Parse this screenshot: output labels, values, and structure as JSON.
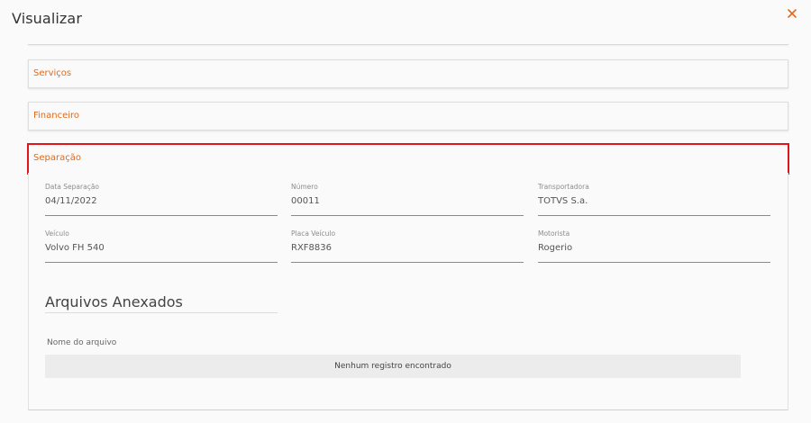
{
  "header": {
    "title": "Visualizar",
    "close_icon": "close-icon",
    "accent_color": "#e06a1b"
  },
  "accordions": [
    {
      "label": "Serviços",
      "expanded": false
    },
    {
      "label": "Financeiro",
      "expanded": false
    },
    {
      "label": "Separação",
      "expanded": true,
      "highlight_color": "#e0161b"
    }
  ],
  "separacao": {
    "fields": [
      {
        "label": "Data Separação",
        "value": "04/11/2022"
      },
      {
        "label": "Número",
        "value": "00011"
      },
      {
        "label": "Transportadora",
        "value": "TOTVS S.a."
      },
      {
        "label": "Veículo",
        "value": "Volvo FH 540"
      },
      {
        "label": "Placa Veículo",
        "value": "RXF8836"
      },
      {
        "label": "Motorista",
        "value": "Rogerio"
      }
    ],
    "attachments": {
      "title": "Arquivos Anexados",
      "columns": [
        "Nome do arquivo"
      ],
      "empty_text": "Nenhum registro encontrado"
    }
  }
}
